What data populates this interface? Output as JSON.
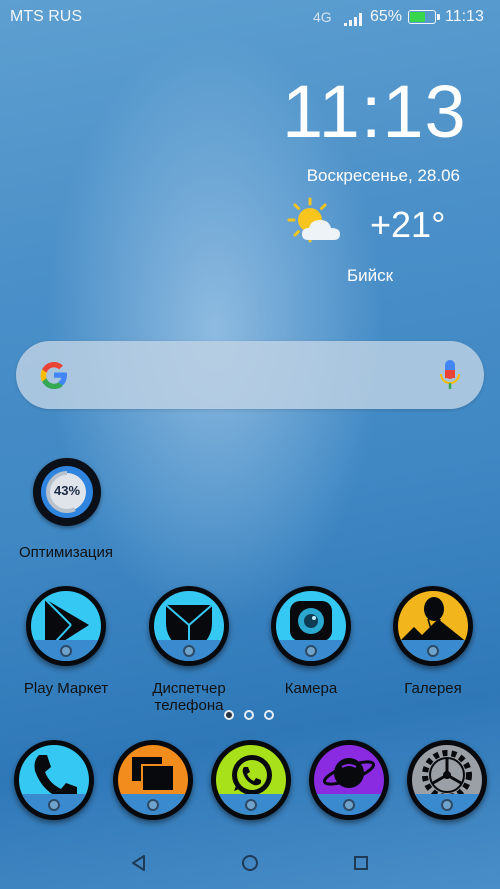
{
  "status_bar": {
    "carrier": "MTS RUS",
    "network": "4G",
    "battery_percent": "65%",
    "battery_level": 0.65,
    "time": "11:13"
  },
  "clock_widget": {
    "time": "11:13",
    "date": "Воскресенье, 28.06",
    "temperature": "+21°",
    "city": "Бийск",
    "weather_icon": "partly-cloudy-icon"
  },
  "search": {
    "logo_icon": "google-icon",
    "mic_icon": "mic-icon"
  },
  "optimization": {
    "percent": "43%",
    "level": 0.43,
    "label": "Оптимизация"
  },
  "apps_row": [
    {
      "label": "Play Маркет",
      "icon": "play-store-icon"
    },
    {
      "label": "Диспетчер телефона",
      "icon": "phone-manager-icon"
    },
    {
      "label": "Камера",
      "icon": "camera-icon"
    },
    {
      "label": "Галерея",
      "icon": "gallery-icon"
    }
  ],
  "pager": {
    "pages": 3,
    "current": 1
  },
  "dock": [
    {
      "icon": "phone-icon"
    },
    {
      "icon": "messages-icon"
    },
    {
      "icon": "whatsapp-icon"
    },
    {
      "icon": "browser-icon"
    },
    {
      "icon": "settings-icon"
    }
  ],
  "navigation": {
    "back": "back-icon",
    "home": "home-icon",
    "recents": "recents-icon"
  },
  "colors": {
    "play": "#35c8f2",
    "manager": "#35c8f2",
    "camera": "#35c8f2",
    "gallery": "#f2b61c",
    "phone": "#35c8f2",
    "messages": "#f28c1c",
    "whatsapp": "#a8e01a",
    "browser": "#8a2be2",
    "settings": "#9aa0a6"
  }
}
